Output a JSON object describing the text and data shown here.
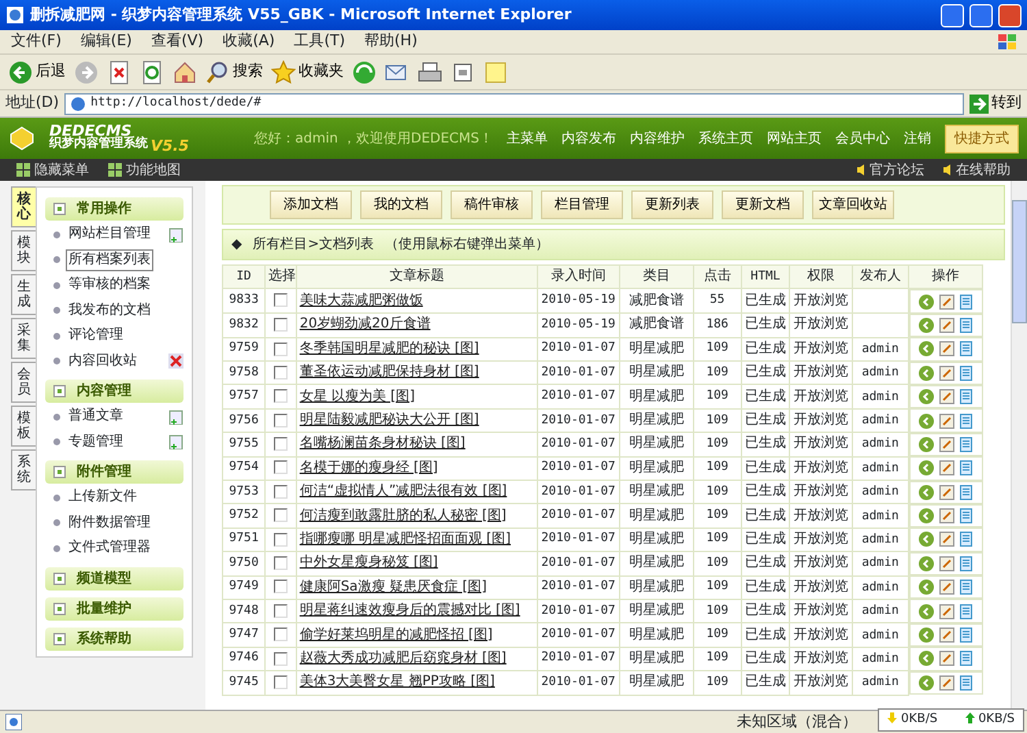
{
  "window": {
    "title": "删拆减肥网 - 织梦内容管理系统 V55_GBK - Microsoft Internet Explorer"
  },
  "menu": [
    "文件(F)",
    "编辑(E)",
    "查看(V)",
    "收藏(A)",
    "工具(T)",
    "帮助(H)"
  ],
  "toolbar": [
    {
      "kind": "back",
      "label": "后退"
    },
    {
      "kind": "forward"
    },
    {
      "kind": "stop"
    },
    {
      "kind": "refresh"
    },
    {
      "kind": "home"
    },
    {
      "kind": "search",
      "label": "搜索"
    },
    {
      "kind": "favorites",
      "label": "收藏夹"
    },
    {
      "kind": "media"
    },
    {
      "kind": "mail"
    },
    {
      "kind": "print"
    },
    {
      "kind": "edit"
    },
    {
      "kind": "note"
    }
  ],
  "address": {
    "label": "地址(D)",
    "value": "http://localhost/dede/#",
    "go": "转到"
  },
  "header": {
    "logo": "DEDECMS",
    "subtitle": "织梦内容管理系统",
    "version": "V5.5",
    "greeting": "您好：admin ，欢迎使用DEDECMS！",
    "nav": [
      "主菜单",
      "内容发布",
      "内容维护",
      "系统主页",
      "网站主页",
      "会员中心",
      "注销"
    ],
    "shortcut": "快捷方式"
  },
  "subbar": {
    "left": [
      "隐藏菜单",
      "功能地图"
    ],
    "right": [
      "官方论坛",
      "在线帮助"
    ]
  },
  "side_tabs": [
    {
      "label": "核心",
      "selected": true
    },
    {
      "label": "模块",
      "selected": false
    },
    {
      "label": "生成",
      "selected": false
    },
    {
      "label": "采集",
      "selected": false
    },
    {
      "label": "会员",
      "selected": false
    },
    {
      "label": "模板",
      "selected": false
    },
    {
      "label": "系统",
      "selected": false
    }
  ],
  "menu_groups": [
    {
      "title": "常用操作",
      "items": [
        {
          "label": "网站栏目管理",
          "kind": "add",
          "selected": false
        },
        {
          "label": "所有档案列表",
          "kind": "plain",
          "selected": true
        },
        {
          "label": "等审核的档案",
          "kind": "plain",
          "selected": false
        },
        {
          "label": "我发布的文档",
          "kind": "plain",
          "selected": false
        },
        {
          "label": "评论管理",
          "kind": "plain",
          "selected": false
        },
        {
          "label": "内容回收站",
          "kind": "delete",
          "selected": false
        }
      ]
    },
    {
      "title": "内容管理",
      "items": [
        {
          "label": "普通文章",
          "kind": "add",
          "selected": false
        },
        {
          "label": "专题管理",
          "kind": "add",
          "selected": false
        }
      ]
    },
    {
      "title": "附件管理",
      "items": [
        {
          "label": "上传新文件",
          "kind": "plain",
          "selected": false
        },
        {
          "label": "附件数据管理",
          "kind": "plain",
          "selected": false
        },
        {
          "label": "文件式管理器",
          "kind": "plain",
          "selected": false
        }
      ]
    },
    {
      "title": "频道模型"
    },
    {
      "title": "批量维护"
    },
    {
      "title": "系统帮助"
    }
  ],
  "buttons": [
    "添加文档",
    "我的文档",
    "稿件审核",
    "栏目管理",
    "更新列表",
    "更新文档",
    "文章回收站"
  ],
  "list": {
    "marker": "◆",
    "path": "所有栏目>文档列表",
    "hint": "（使用鼠标右键弹出菜单）",
    "columns": [
      "ID",
      "选择",
      "文章标题",
      "录入时间",
      "类目",
      "点击",
      "HTML",
      "权限",
      "发布人",
      "操作"
    ],
    "rows": [
      {
        "id": "9833",
        "checked": false,
        "title": "美味大蒜减肥粥做饭",
        "date": "2010-05-19",
        "category": "减肥食谱",
        "clicks": "55",
        "html": "已生成",
        "access": "开放浏览"
      },
      {
        "id": "9832",
        "checked": false,
        "title": "20岁蝴劲减20斤食谱",
        "date": "2010-05-19",
        "category": "减肥食谱",
        "clicks": "186",
        "html": "已生成",
        "access": "开放浏览"
      },
      {
        "id": "9759",
        "checked": false,
        "title": "冬季韩国明星减肥的秘诀 [图]",
        "date": "2010-01-07",
        "category": "明星减肥",
        "clicks": "109",
        "html": "已生成",
        "access": "开放浏览",
        "publisher": "admin"
      },
      {
        "id": "9758",
        "checked": false,
        "title": "董圣依运动减肥保持身材 [图]",
        "date": "2010-01-07",
        "category": "明星减肥",
        "clicks": "109",
        "html": "已生成",
        "access": "开放浏览",
        "publisher": "admin"
      },
      {
        "id": "9757",
        "checked": false,
        "title": "女星 以瘦为美 [图]",
        "date": "2010-01-07",
        "category": "明星减肥",
        "clicks": "109",
        "html": "已生成",
        "access": "开放浏览",
        "publisher": "admin"
      },
      {
        "id": "9756",
        "checked": false,
        "title": "明星陆毅减肥秘诀大公开 [图]",
        "date": "2010-01-07",
        "category": "明星减肥",
        "clicks": "109",
        "html": "已生成",
        "access": "开放浏览",
        "publisher": "admin"
      },
      {
        "id": "9755",
        "checked": false,
        "title": "名嘴杨澜苗条身材秘诀 [图]",
        "date": "2010-01-07",
        "category": "明星减肥",
        "clicks": "109",
        "html": "已生成",
        "access": "开放浏览",
        "publisher": "admin"
      },
      {
        "id": "9754",
        "checked": false,
        "title": "名模于娜的瘦身经 [图]",
        "date": "2010-01-07",
        "category": "明星减肥",
        "clicks": "109",
        "html": "已生成",
        "access": "开放浏览",
        "publisher": "admin"
      },
      {
        "id": "9753",
        "checked": false,
        "title": "何洁“虚拟情人”减肥法很有效 [图]",
        "date": "2010-01-07",
        "category": "明星减肥",
        "clicks": "109",
        "html": "已生成",
        "access": "开放浏览",
        "publisher": "admin"
      },
      {
        "id": "9752",
        "checked": false,
        "title": "何洁瘦到敢露肚脐的私人秘密 [图]",
        "date": "2010-01-07",
        "category": "明星减肥",
        "clicks": "109",
        "html": "已生成",
        "access": "开放浏览",
        "publisher": "admin"
      },
      {
        "id": "9751",
        "checked": false,
        "title": "指哪瘦哪 明星减肥怪招面面观 [图]",
        "date": "2010-01-07",
        "category": "明星减肥",
        "clicks": "109",
        "html": "已生成",
        "access": "开放浏览",
        "publisher": "admin"
      },
      {
        "id": "9750",
        "checked": false,
        "title": "中外女星瘦身秘笈 [图]",
        "date": "2010-01-07",
        "category": "明星减肥",
        "clicks": "109",
        "html": "已生成",
        "access": "开放浏览",
        "publisher": "admin"
      },
      {
        "id": "9749",
        "checked": false,
        "title": "健康阿Sa激瘦 疑患厌食症 [图]",
        "date": "2010-01-07",
        "category": "明星减肥",
        "clicks": "109",
        "html": "已生成",
        "access": "开放浏览",
        "publisher": "admin"
      },
      {
        "id": "9748",
        "checked": false,
        "title": "明星蒋纠速效瘦身后的震撼对比 [图]",
        "date": "2010-01-07",
        "category": "明星减肥",
        "clicks": "109",
        "html": "已生成",
        "access": "开放浏览",
        "publisher": "admin"
      },
      {
        "id": "9747",
        "checked": false,
        "title": "偷学好莱坞明星的减肥怪招 [图]",
        "date": "2010-01-07",
        "category": "明星减肥",
        "clicks": "109",
        "html": "已生成",
        "access": "开放浏览",
        "publisher": "admin"
      },
      {
        "id": "9746",
        "checked": false,
        "title": "赵薇大秀成功减肥后窈窕身材 [图]",
        "date": "2010-01-07",
        "category": "明星减肥",
        "clicks": "109",
        "html": "已生成",
        "access": "开放浏览",
        "publisher": "admin"
      },
      {
        "id": "9745",
        "checked": false,
        "title": "美体3大美臀女星 翘PP攻略 [图]",
        "date": "2010-01-07",
        "category": "明星减肥",
        "clicks": "109",
        "html": "已生成",
        "access": "开放浏览",
        "publisher": "admin"
      }
    ]
  },
  "status_bar": {
    "zone": "未知区域（混合）",
    "down": "0KB/S",
    "up": "0KB/S"
  }
}
